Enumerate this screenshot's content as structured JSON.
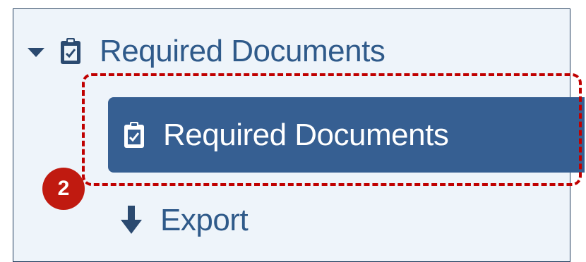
{
  "tree": {
    "parent": {
      "label": "Required Documents",
      "icon": "clipboard-check-icon",
      "expanded": true
    },
    "selected_child": {
      "label": "Required Documents",
      "icon": "clipboard-check-icon"
    },
    "export": {
      "label": "Export",
      "icon": "arrow-down-icon"
    }
  },
  "callout": {
    "step_number": "2"
  },
  "colors": {
    "panel_bg": "#eef4fa",
    "panel_border": "#1f3b5c",
    "text_link": "#2f5a8a",
    "selected_bg": "#365f92",
    "highlight_red": "#c00000",
    "badge_red": "#c01a10"
  }
}
